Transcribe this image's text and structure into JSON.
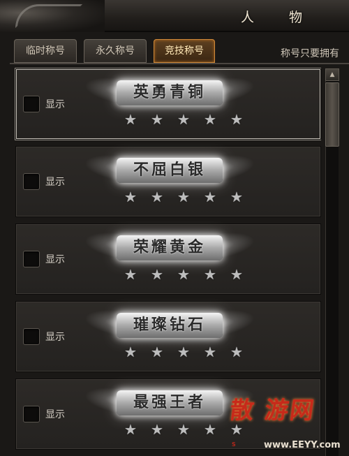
{
  "window": {
    "title": "人 物"
  },
  "tabs": [
    {
      "label": "临时称号",
      "active": false
    },
    {
      "label": "永久称号",
      "active": false
    },
    {
      "label": "竞技称号",
      "active": true
    }
  ],
  "hint": "称号只要拥有",
  "titles": [
    {
      "checkbox_label": "显示",
      "checked": false,
      "badge": "英勇青铜",
      "stars": 5
    },
    {
      "checkbox_label": "显示",
      "checked": false,
      "badge": "不屈白银",
      "stars": 5
    },
    {
      "checkbox_label": "显示",
      "checked": false,
      "badge": "荣耀黄金",
      "stars": 5
    },
    {
      "checkbox_label": "显示",
      "checked": false,
      "badge": "璀璨钻石",
      "stars": 5
    },
    {
      "checkbox_label": "显示",
      "checked": false,
      "badge": "最强王者",
      "stars": 5
    }
  ],
  "scrollbar": {
    "up_icon": "triangle-up"
  },
  "watermark": {
    "text": "散 游网",
    "sub": "www.EEYY.com",
    "tiny": "S"
  },
  "colors": {
    "active_tab": "#d08a3a",
    "watermark": "#c72a1a"
  }
}
